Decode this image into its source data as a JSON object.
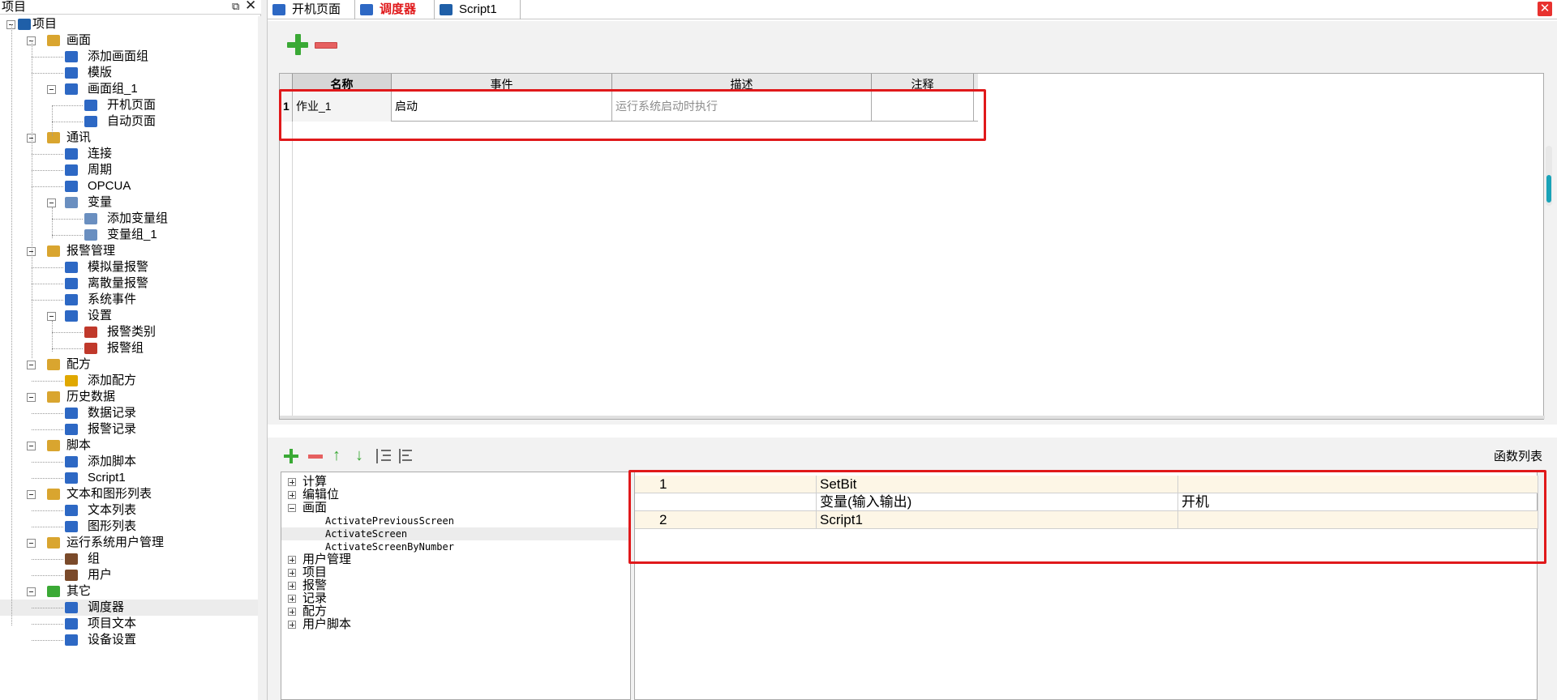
{
  "project_panel": {
    "title": "项目",
    "tree": [
      {
        "label": "项目",
        "level": 0,
        "expander": true,
        "icon": "factory-icon",
        "color": "#1f5fa8"
      },
      {
        "label": "画面",
        "level": 1,
        "expander": true,
        "icon": "screens-folder-icon",
        "color": "#d9a52f"
      },
      {
        "label": "添加画面组",
        "level": 2,
        "expander": false,
        "icon": "add-screen-group-icon",
        "color": "#2d68c4"
      },
      {
        "label": "模版",
        "level": 2,
        "expander": false,
        "icon": "template-icon",
        "color": "#2d68c4"
      },
      {
        "label": "画面组_1",
        "level": 2,
        "expander": true,
        "icon": "screen-group-icon",
        "color": "#2d68c4"
      },
      {
        "label": "开机页面",
        "level": 3,
        "expander": false,
        "icon": "screen-icon",
        "color": "#2d68c4"
      },
      {
        "label": "自动页面",
        "level": 3,
        "expander": false,
        "icon": "screen-icon",
        "color": "#2d68c4"
      },
      {
        "label": "通讯",
        "level": 1,
        "expander": true,
        "icon": "communication-folder-icon",
        "color": "#d9a52f"
      },
      {
        "label": "连接",
        "level": 2,
        "expander": false,
        "icon": "connection-icon",
        "color": "#2d68c4"
      },
      {
        "label": "周期",
        "level": 2,
        "expander": false,
        "icon": "cycle-icon",
        "color": "#2d68c4"
      },
      {
        "label": "OPCUA",
        "level": 2,
        "expander": false,
        "icon": "opcua-icon",
        "color": "#2d68c4"
      },
      {
        "label": "变量",
        "level": 2,
        "expander": true,
        "icon": "variables-icon",
        "color": "#6a8fc0"
      },
      {
        "label": "添加变量组",
        "level": 3,
        "expander": false,
        "icon": "add-variable-group-icon",
        "color": "#6a8fc0"
      },
      {
        "label": "变量组_1",
        "level": 3,
        "expander": false,
        "icon": "variable-group-icon",
        "color": "#6a8fc0"
      },
      {
        "label": "报警管理",
        "level": 1,
        "expander": true,
        "icon": "alarm-folder-icon",
        "color": "#d9a52f"
      },
      {
        "label": "模拟量报警",
        "level": 2,
        "expander": false,
        "icon": "analog-alarm-icon",
        "color": "#2d68c4"
      },
      {
        "label": "离散量报警",
        "level": 2,
        "expander": false,
        "icon": "discrete-alarm-icon",
        "color": "#2d68c4"
      },
      {
        "label": "系统事件",
        "level": 2,
        "expander": false,
        "icon": "system-event-icon",
        "color": "#2d68c4"
      },
      {
        "label": "设置",
        "level": 2,
        "expander": true,
        "icon": "settings-icon",
        "color": "#2d68c4"
      },
      {
        "label": "报警类别",
        "level": 3,
        "expander": false,
        "icon": "alarm-class-icon",
        "color": "#c0392b"
      },
      {
        "label": "报警组",
        "level": 3,
        "expander": false,
        "icon": "alarm-group-icon",
        "color": "#c0392b"
      },
      {
        "label": "配方",
        "level": 1,
        "expander": true,
        "icon": "recipe-folder-icon",
        "color": "#d9a52f"
      },
      {
        "label": "添加配方",
        "level": 2,
        "expander": false,
        "icon": "add-recipe-icon",
        "color": "#e0a800"
      },
      {
        "label": "历史数据",
        "level": 1,
        "expander": true,
        "icon": "history-folder-icon",
        "color": "#d9a52f"
      },
      {
        "label": "数据记录",
        "level": 2,
        "expander": false,
        "icon": "data-log-icon",
        "color": "#2d68c4"
      },
      {
        "label": "报警记录",
        "level": 2,
        "expander": false,
        "icon": "alarm-log-icon",
        "color": "#2d68c4"
      },
      {
        "label": "脚本",
        "level": 1,
        "expander": true,
        "icon": "script-folder-icon",
        "color": "#d9a52f"
      },
      {
        "label": "添加脚本",
        "level": 2,
        "expander": false,
        "icon": "add-script-icon",
        "color": "#2d68c4"
      },
      {
        "label": "Script1",
        "level": 2,
        "expander": false,
        "icon": "script-icon",
        "color": "#2d68c4"
      },
      {
        "label": "文本和图形列表",
        "level": 1,
        "expander": true,
        "icon": "lists-folder-icon",
        "color": "#d9a52f"
      },
      {
        "label": "文本列表",
        "level": 2,
        "expander": false,
        "icon": "text-list-icon",
        "color": "#2d68c4"
      },
      {
        "label": "图形列表",
        "level": 2,
        "expander": false,
        "icon": "graphic-list-icon",
        "color": "#2d68c4"
      },
      {
        "label": "运行系统用户管理",
        "level": 1,
        "expander": true,
        "icon": "user-admin-folder-icon",
        "color": "#d9a52f"
      },
      {
        "label": "组",
        "level": 2,
        "expander": false,
        "icon": "group-icon",
        "color": "#7a4a2a"
      },
      {
        "label": "用户",
        "level": 2,
        "expander": false,
        "icon": "user-icon",
        "color": "#7a4a2a"
      },
      {
        "label": "其它",
        "level": 1,
        "expander": true,
        "icon": "other-folder-icon",
        "color": "#3aa935"
      },
      {
        "label": "调度器",
        "level": 2,
        "expander": false,
        "icon": "scheduler-icon",
        "color": "#2d68c4",
        "selected": true
      },
      {
        "label": "项目文本",
        "level": 2,
        "expander": false,
        "icon": "project-text-icon",
        "color": "#2d68c4"
      },
      {
        "label": "设备设置",
        "level": 2,
        "expander": false,
        "icon": "device-settings-icon",
        "color": "#2d68c4"
      }
    ]
  },
  "tabs": [
    {
      "label": "开机页面",
      "icon": "screen-icon",
      "active": false
    },
    {
      "label": "调度器",
      "icon": "scheduler-icon",
      "active": true
    },
    {
      "label": "Script1",
      "icon": "script-icon",
      "active": false
    }
  ],
  "scheduler": {
    "columns": [
      "名称",
      "事件",
      "描述",
      "注释"
    ],
    "rows": [
      {
        "index": "1",
        "name": "作业_1",
        "event": "启动",
        "description": "运行系统启动时执行",
        "comment": ""
      }
    ]
  },
  "function_list_label": "函数列表",
  "function_tree": [
    {
      "label": "计算",
      "expander": "plus",
      "mono": false
    },
    {
      "label": "编辑位",
      "expander": "plus",
      "mono": false
    },
    {
      "label": "画面",
      "expander": "minus",
      "mono": false
    },
    {
      "label": "ActivatePreviousScreen",
      "expander": "none",
      "mono": true
    },
    {
      "label": "ActivateScreen",
      "expander": "none",
      "mono": true,
      "selected": true
    },
    {
      "label": "ActivateScreenByNumber",
      "expander": "none",
      "mono": true
    },
    {
      "label": "用户管理",
      "expander": "plus",
      "mono": false
    },
    {
      "label": "项目",
      "expander": "plus",
      "mono": false
    },
    {
      "label": "报警",
      "expander": "plus",
      "mono": false
    },
    {
      "label": "记录",
      "expander": "plus",
      "mono": false
    },
    {
      "label": "配方",
      "expander": "plus",
      "mono": false
    },
    {
      "label": "用户脚本",
      "expander": "plus",
      "mono": false
    }
  ],
  "function_table": [
    {
      "col1": "1",
      "col2": "SetBit",
      "col3": ""
    },
    {
      "col1": "",
      "col2": "变量(输入输出)",
      "col3": "开机"
    },
    {
      "col1": "2",
      "col2": "Script1",
      "col3": ""
    }
  ],
  "colors": {
    "highlight": "#e0191b",
    "add": "#3aa935",
    "remove": "#e66060",
    "active_tab": "#e0191b"
  }
}
